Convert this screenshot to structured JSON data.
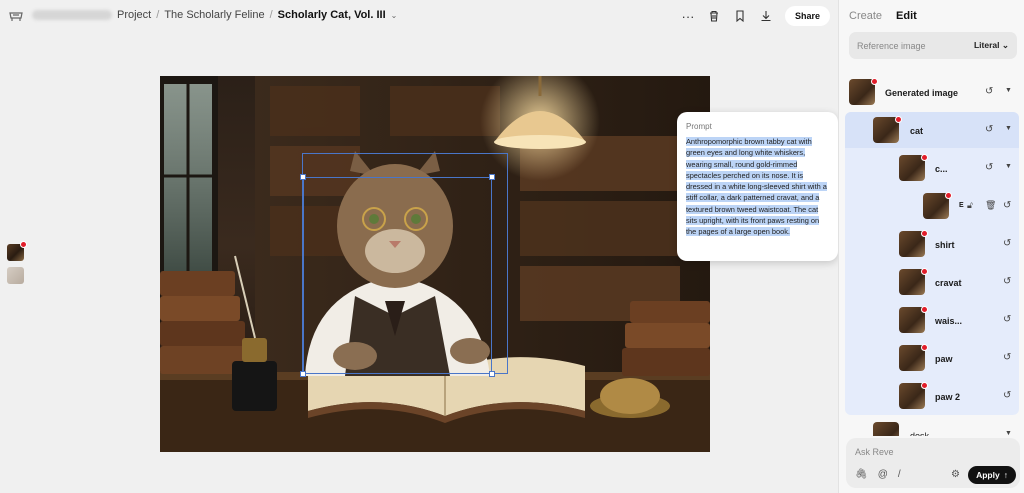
{
  "breadcrumb": {
    "project_label": "Project",
    "folder": "The Scholarly Feline",
    "current": "Scholarly Cat, Vol. III"
  },
  "toolbar": {
    "more_icon": "more-horizontal-icon",
    "delete_icon": "trash-icon",
    "bookmark_icon": "bookmark-icon",
    "download_icon": "download-icon",
    "share_label": "Share"
  },
  "prompt": {
    "title": "Prompt",
    "text": "Anthropomorphic brown tabby cat with green eyes and long white whiskers, wearing small, round gold-rimmed spectacles perched on its nose. It is dressed in a white long-sleeved shirt with a stiff collar, a dark patterned cravat, and a textured brown tweed waistcoat. The cat sits upright, with its front paws resting on the pages of a large open book."
  },
  "panel": {
    "tab_create": "Create",
    "tab_edit": "Edit",
    "reference_placeholder": "Reference image",
    "reference_mode": "Literal",
    "layers": [
      {
        "label": "Generated image",
        "level": 0
      },
      {
        "label": "cat",
        "level": 1
      },
      {
        "label": "c...",
        "level": 2
      },
      {
        "label": "E",
        "level": 3
      },
      {
        "label": "shirt",
        "level": 2
      },
      {
        "label": "cravat",
        "level": 2
      },
      {
        "label": "wais...",
        "level": 2
      },
      {
        "label": "paw",
        "level": 2
      },
      {
        "label": "paw 2",
        "level": 2
      },
      {
        "label": "desk",
        "level": 1
      }
    ]
  },
  "chat": {
    "placeholder": "Ask Reve",
    "apply_label": "Apply"
  },
  "colors": {
    "accent_selection": "#4a76c8",
    "highlight": "#bcd4f6",
    "badge": "#e11d2a",
    "layer_group_bg": "#e5ecfb"
  }
}
